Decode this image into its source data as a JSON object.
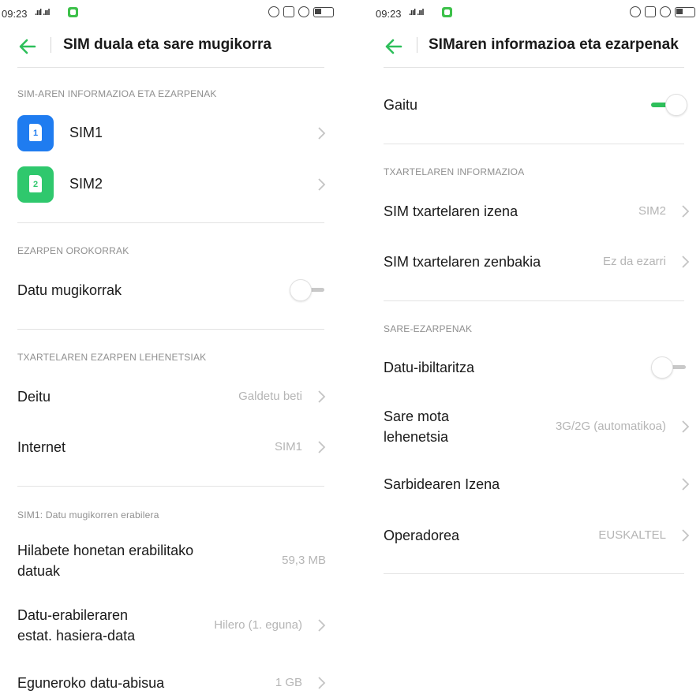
{
  "left": {
    "status": {
      "time": "09:23",
      "signal": ".ııl .ııl"
    },
    "header": {
      "title": "SIM duala eta sare mugikorra"
    },
    "sections": {
      "sim_info": "SIM-AREN INFORMAZIOA ETA EZARPENAK",
      "general": "EZARPEN OROKORRAK",
      "default_card": "TXARTELAREN EZARPEN LEHENETSIAK",
      "usage": "SIM1: Datu mugikorren erabilera"
    },
    "sims": [
      {
        "label": "SIM1",
        "number": "1",
        "color": "#1f7cf0"
      },
      {
        "label": "SIM2",
        "number": "2",
        "color": "#2fc86d"
      }
    ],
    "mobile_data": {
      "label": "Datu mugikorrak",
      "enabled": false
    },
    "call": {
      "label": "Deitu",
      "value": "Galdetu beti"
    },
    "internet": {
      "label": "Internet",
      "value": "SIM1"
    },
    "month_data": {
      "label_line1": "Hilabete honetan erabilitako",
      "label_line2": "datuak",
      "value": "59,3 MB"
    },
    "stats_start": {
      "label_line1": "Datu-erabileraren",
      "label_line2": "estat. hasiera-data",
      "value": "Hilero (1. eguna)"
    },
    "daily_warning": {
      "label": "Eguneroko datu-abisua",
      "value": "1 GB"
    }
  },
  "right": {
    "status": {
      "time": "09:23",
      "signal": ".ııl .ııl"
    },
    "header": {
      "title": "SIMaren informazioa eta ezarpenak"
    },
    "enable": {
      "label": "Gaitu",
      "enabled": true
    },
    "sections": {
      "card_info": "TXARTELAREN INFORMAZIOA",
      "network": "SARE-EZARPENAK"
    },
    "sim_name": {
      "label": "SIM txartelaren izena",
      "value": "SIM2"
    },
    "sim_number": {
      "label": "SIM txartelaren zenbakia",
      "value": "Ez da ezarri"
    },
    "roaming": {
      "label": "Datu-ibiltaritza",
      "enabled": false
    },
    "network_type": {
      "label_line1": "Sare mota",
      "label_line2": "lehenetsia",
      "value": "3G/2G (automatikoa)"
    },
    "apn": {
      "label": "Sarbidearen Izena"
    },
    "operator": {
      "label": "Operadorea",
      "value": "EUSKALTEL"
    }
  },
  "colors": {
    "accent": "#2dbf5a",
    "sim1": "#1f7cf0",
    "sim2": "#2fc86d",
    "muted": "#8f8f8f",
    "value": "#b5b5b5"
  }
}
